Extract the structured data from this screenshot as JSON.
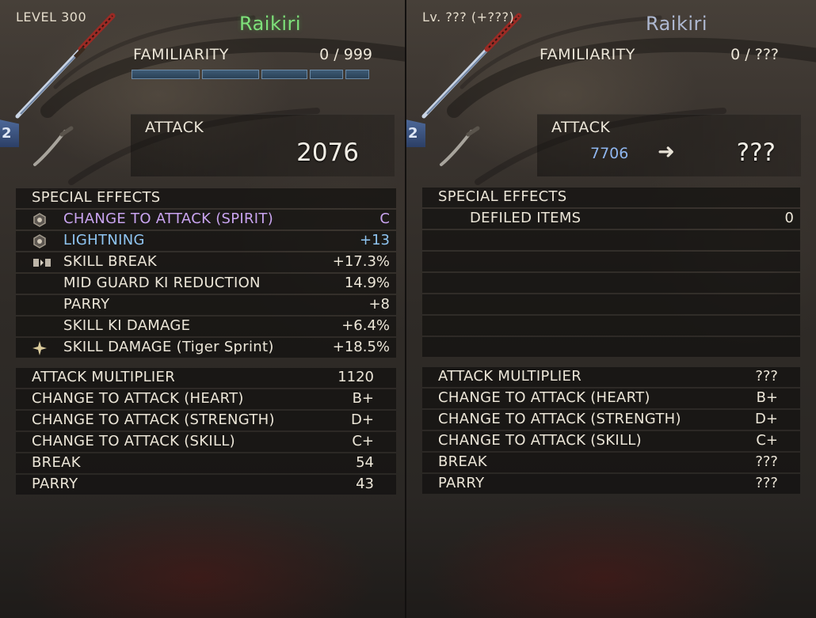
{
  "left": {
    "level": "LEVEL 300",
    "weapon_name": "Raikiri",
    "familiarity": {
      "label": "FAMILIARITY",
      "value": "0 / 999",
      "fill": 0
    },
    "badge": "2",
    "attack": {
      "label": "ATTACK",
      "value": "2076"
    },
    "special_effects_title": "SPECIAL EFFECTS",
    "effects": [
      {
        "name": "CHANGE TO ATTACK (SPIRIT)",
        "value": "C",
        "color": "#c9a4f0",
        "icon": "spirit-gem-icon"
      },
      {
        "name": "LIGHTNING",
        "value": "+13",
        "color": "#8fc5f2",
        "icon": "spirit-gem-icon"
      },
      {
        "name": "SKILL BREAK",
        "value": "+17.3%",
        "icon": "set-bonus-icon"
      },
      {
        "name": "MID GUARD KI REDUCTION",
        "value": "14.9%"
      },
      {
        "name": "PARRY",
        "value": "+8"
      },
      {
        "name": "SKILL KI DAMAGE",
        "value": "+6.4%"
      },
      {
        "name": "SKILL DAMAGE (Tiger Sprint)",
        "value": "+18.5%",
        "icon": "sparkle-icon"
      }
    ],
    "stats": [
      {
        "name": "ATTACK MULTIPLIER",
        "value": "1120"
      },
      {
        "name": "CHANGE TO ATTACK (HEART)",
        "value": "B+"
      },
      {
        "name": "CHANGE TO ATTACK (STRENGTH)",
        "value": "D+"
      },
      {
        "name": "CHANGE TO ATTACK (SKILL)",
        "value": "C+"
      },
      {
        "name": "BREAK",
        "value": "54"
      },
      {
        "name": "PARRY",
        "value": "43"
      }
    ]
  },
  "right": {
    "level": "Lv. ??? (+???)",
    "weapon_name": "Raikiri",
    "familiarity": {
      "label": "FAMILIARITY",
      "value": "0 / ???"
    },
    "badge": "2",
    "attack": {
      "label": "ATTACK",
      "old_value": "7706",
      "arrow": "➜",
      "new_value": "???"
    },
    "special_effects_title": "SPECIAL EFFECTS",
    "effects": [
      {
        "name": "DEFILED ITEMS",
        "value": "0"
      }
    ],
    "stats": [
      {
        "name": "ATTACK MULTIPLIER",
        "value": "???"
      },
      {
        "name": "CHANGE TO ATTACK (HEART)",
        "value": "B+"
      },
      {
        "name": "CHANGE TO ATTACK (STRENGTH)",
        "value": "D+"
      },
      {
        "name": "CHANGE TO ATTACK (SKILL)",
        "value": "C+"
      },
      {
        "name": "BREAK",
        "value": "???"
      },
      {
        "name": "PARRY",
        "value": "???"
      }
    ]
  }
}
